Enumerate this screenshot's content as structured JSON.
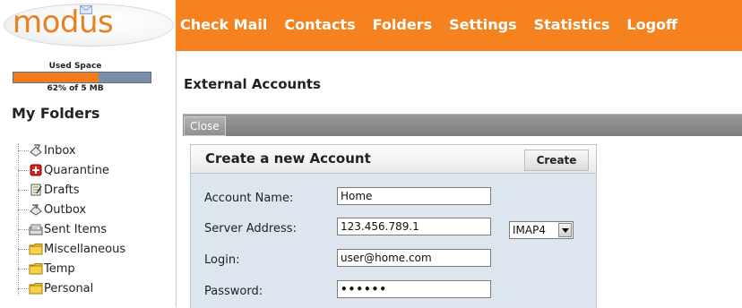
{
  "logo": {
    "text": "modus"
  },
  "nav": {
    "items": [
      {
        "label": "Check Mail"
      },
      {
        "label": "Contacts"
      },
      {
        "label": "Folders"
      },
      {
        "label": "Settings"
      },
      {
        "label": "Statistics"
      },
      {
        "label": "Logoff"
      }
    ]
  },
  "sidebar": {
    "used_space_label": "Used Space",
    "quota_text": "62% of 5 MB",
    "quota_fraction": 0.62,
    "folders_title": "My Folders",
    "folders": [
      {
        "label": "Inbox",
        "icon": "inbox-icon"
      },
      {
        "label": "Quarantine",
        "icon": "quarantine-icon"
      },
      {
        "label": "Drafts",
        "icon": "drafts-icon"
      },
      {
        "label": "Outbox",
        "icon": "outbox-icon"
      },
      {
        "label": "Sent Items",
        "icon": "sent-items-icon"
      },
      {
        "label": "Miscellaneous",
        "icon": "folder-icon"
      },
      {
        "label": "Temp",
        "icon": "folder-icon"
      },
      {
        "label": "Personal",
        "icon": "folder-icon"
      }
    ]
  },
  "main": {
    "title": "External Accounts",
    "toolbar": {
      "close_label": "Close"
    },
    "panel": {
      "title": "Create a new Account",
      "create_label": "Create",
      "fields": {
        "account_name": {
          "label": "Account Name:",
          "value": "Home"
        },
        "server_address": {
          "label": "Server Address:",
          "value": "123.456.789.1"
        },
        "protocol": {
          "value": "IMAP4"
        },
        "login": {
          "label": "Login:",
          "value": "user@home.com"
        },
        "password": {
          "label": "Password:",
          "value": "••••••"
        }
      }
    }
  },
  "colors": {
    "brand_orange": "#f5821f",
    "quota_used": "#f07c1c",
    "quota_free": "#7b8ea7",
    "panel_bg": "#dde6ef"
  }
}
